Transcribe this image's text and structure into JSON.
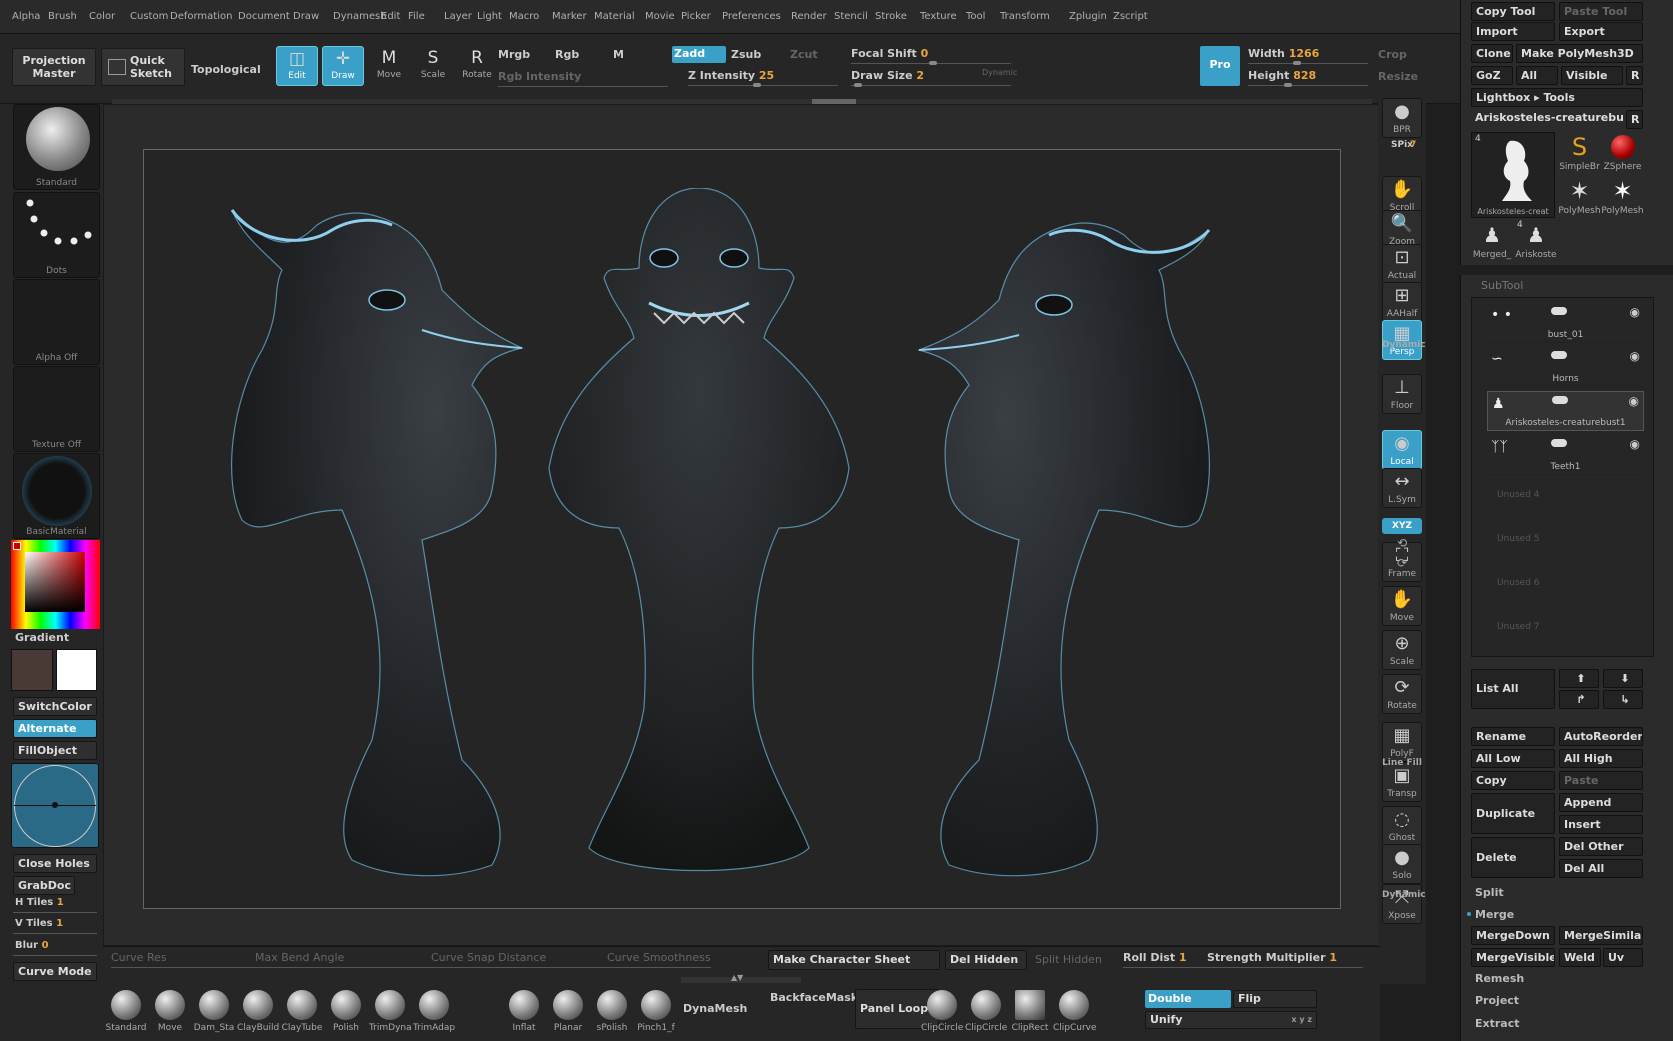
{
  "menu": [
    "Alpha",
    "Brush",
    "Color",
    "Custom",
    "Deformation",
    "Document",
    "Draw",
    "Dynamesh",
    "Edit",
    "File",
    "Layer",
    "Light",
    "Macro",
    "Marker",
    "Material",
    "Movie",
    "Picker",
    "Preferences",
    "Render",
    "Stencil",
    "Stroke",
    "Texture",
    "Tool",
    "Transform",
    "Zplugin",
    "Zscript"
  ],
  "top": {
    "projection_master": "Projection Master",
    "quick_sketch": "Quick Sketch",
    "topological": "Topological",
    "tools": [
      {
        "label": "Edit",
        "icon": "edit-icon",
        "glyph": "◫",
        "active": true
      },
      {
        "label": "Draw",
        "icon": "draw-icon",
        "glyph": "✛",
        "active": true
      },
      {
        "label": "Move",
        "icon": "move-icon",
        "glyph": "M",
        "active": false
      },
      {
        "label": "Scale",
        "icon": "scale-icon",
        "glyph": "S",
        "active": false
      },
      {
        "label": "Rotate",
        "icon": "rotate-icon",
        "glyph": "R",
        "active": false
      }
    ],
    "mrgb": "Mrgb",
    "rgb": "Rgb",
    "m": "M",
    "rgb_intensity": "Rgb Intensity",
    "zadd": "Zadd",
    "zsub": "Zsub",
    "zcut": "Zcut",
    "z_intensity_label": "Z Intensity",
    "z_intensity": "25",
    "focal_shift_label": "Focal Shift",
    "focal_shift": "0",
    "draw_size_label": "Draw Size",
    "draw_size": "2",
    "dynamic": "Dynamic",
    "pro": "Pro",
    "width_label": "Width",
    "width": "1266",
    "height_label": "Height",
    "height": "828",
    "crop": "Crop",
    "resize": "Resize"
  },
  "left": {
    "brush_label": "Standard",
    "stroke_label": "Dots",
    "alpha_label": "Alpha Off",
    "texture_label": "Texture Off",
    "material_label": "BasicMaterial",
    "gradient": "Gradient",
    "switch_color": "SwitchColor",
    "alternate": "Alternate",
    "fill_object": "FillObject",
    "close_holes": "Close Holes",
    "grab_doc": "GrabDoc",
    "h_tiles_label": "H Tiles",
    "h_tiles": "1",
    "v_tiles_label": "V Tiles",
    "v_tiles": "1",
    "blur_label": "Blur",
    "blur": "0",
    "curve_mode": "Curve Mode",
    "main_color": "#4a3a36",
    "secondary_color": "#ffffff"
  },
  "shelf": [
    {
      "label": "BPR",
      "icon": "bpr-icon",
      "glyph": "●",
      "on": false
    },
    {
      "label": "Scroll",
      "icon": "scroll-icon",
      "glyph": "✋",
      "on": false
    },
    {
      "label": "Zoom",
      "icon": "zoom-icon",
      "glyph": "🔍",
      "on": false
    },
    {
      "label": "Actual",
      "icon": "actual-icon",
      "glyph": "⊡",
      "on": false
    },
    {
      "label": "AAHalf",
      "icon": "aahalf-icon",
      "glyph": "⊞",
      "on": false
    },
    {
      "label": "Persp",
      "icon": "persp-icon",
      "glyph": "▦",
      "on": true
    },
    {
      "label": "Floor",
      "icon": "floor-icon",
      "glyph": "⊥",
      "on": false
    },
    {
      "label": "Local",
      "icon": "local-icon",
      "glyph": "◉",
      "on": true
    },
    {
      "label": "L.Sym",
      "icon": "lsym-icon",
      "glyph": "↔",
      "on": false
    },
    {
      "label": "Frame",
      "icon": "frame-icon",
      "glyph": "⛶",
      "on": false
    },
    {
      "label": "Move",
      "icon": "move-view-icon",
      "glyph": "✋",
      "on": false
    },
    {
      "label": "Scale",
      "icon": "scale-view-icon",
      "glyph": "⊕",
      "on": false
    },
    {
      "label": "Rotate",
      "icon": "rotate-view-icon",
      "glyph": "⟳",
      "on": false
    },
    {
      "label": "PolyF",
      "icon": "polyf-icon",
      "glyph": "▦",
      "on": false
    },
    {
      "label": "Transp",
      "icon": "transp-icon",
      "glyph": "▣",
      "on": false
    },
    {
      "label": "Ghost",
      "icon": "ghost-icon",
      "glyph": "◌",
      "on": false
    },
    {
      "label": "Solo",
      "icon": "solo-icon",
      "glyph": "●",
      "on": false
    },
    {
      "label": "Xpose",
      "icon": "xpose-icon",
      "glyph": "⤧",
      "on": false
    }
  ],
  "shelf_misc": {
    "spix_label": "SPix",
    "spix": "7",
    "dynamic": "Dynamic",
    "xyz": "XYZ",
    "line_fill": "Line Fill",
    "dynamic2": "Dynamic"
  },
  "tool": {
    "copy_tool": "Copy Tool",
    "paste_tool": "Paste Tool",
    "import": "Import",
    "export": "Export",
    "clone": "Clone",
    "make_polymesh": "Make PolyMesh3D",
    "goz": "GoZ",
    "all": "All",
    "visible": "Visible",
    "r": "R",
    "lightbox_tools": "Lightbox ▸ Tools",
    "current_tool": "Ariskosteles-creaturebus",
    "r2": "R",
    "thumb_count": "4",
    "thumbs": [
      "Ariskosteles-creat",
      "SimpleBr",
      "ZSphere",
      "PolyMesh",
      "PolyMesh",
      "Merged_",
      "Ariskoste"
    ],
    "thumb_count2": "4"
  },
  "subtool": {
    "title": "SubTool",
    "items": [
      {
        "name": "bust_01",
        "selected": false
      },
      {
        "name": "Horns",
        "selected": false
      },
      {
        "name": "Ariskosteles-creaturebust1",
        "selected": true
      },
      {
        "name": "Teeth1",
        "selected": false
      }
    ],
    "unused": [
      "Unused 4",
      "Unused 5",
      "Unused 6",
      "Unused 7"
    ],
    "list_all": "List  All",
    "rename": "Rename",
    "auto_reorder": "AutoReorder",
    "all_low": "All Low",
    "all_high": "All High",
    "copy": "Copy",
    "paste": "Paste",
    "duplicate": "Duplicate",
    "append": "Append",
    "insert": "Insert",
    "delete": "Delete",
    "del_other": "Del Other",
    "del_all": "Del All",
    "split": "Split",
    "merge": "Merge",
    "merge_down": "MergeDown",
    "merge_similar": "MergeSimilar",
    "merge_visible": "MergeVisible",
    "weld": "Weld",
    "uv": "Uv",
    "remesh": "Remesh",
    "project": "Project",
    "extract": "Extract"
  },
  "bottom": {
    "curve_res": "Curve Res",
    "max_bend": "Max Bend Angle",
    "curve_snap": "Curve Snap Distance",
    "curve_smooth": "Curve Smoothness",
    "make_sheet": "Make Character Sheet",
    "del_hidden": "Del Hidden",
    "split_hidden": "Split Hidden",
    "roll_dist_label": "Roll Dist",
    "roll_dist": "1",
    "strength_label": "Strength Multiplier",
    "strength": "1",
    "brushes_left": [
      "Standard",
      "Move",
      "Dam_Sta",
      "ClayBuild",
      "ClayTube",
      "Polish",
      "TrimDyna",
      "TrimAdap"
    ],
    "brushes_mid": [
      "Inflat",
      "Planar",
      "sPolish",
      "Pinch1_f"
    ],
    "dynamesh": "DynaMesh",
    "backface": "BackfaceMask",
    "panel_loops": "Panel Loops",
    "clips": [
      "ClipCircle",
      "ClipCircle",
      "ClipRect",
      "ClipCurve"
    ],
    "double": "Double",
    "flip": "Flip",
    "unify": "Unify",
    "xyz": "x y z"
  },
  "colors": {
    "accent": "#3aa0c8",
    "value": "#e8a53c"
  }
}
